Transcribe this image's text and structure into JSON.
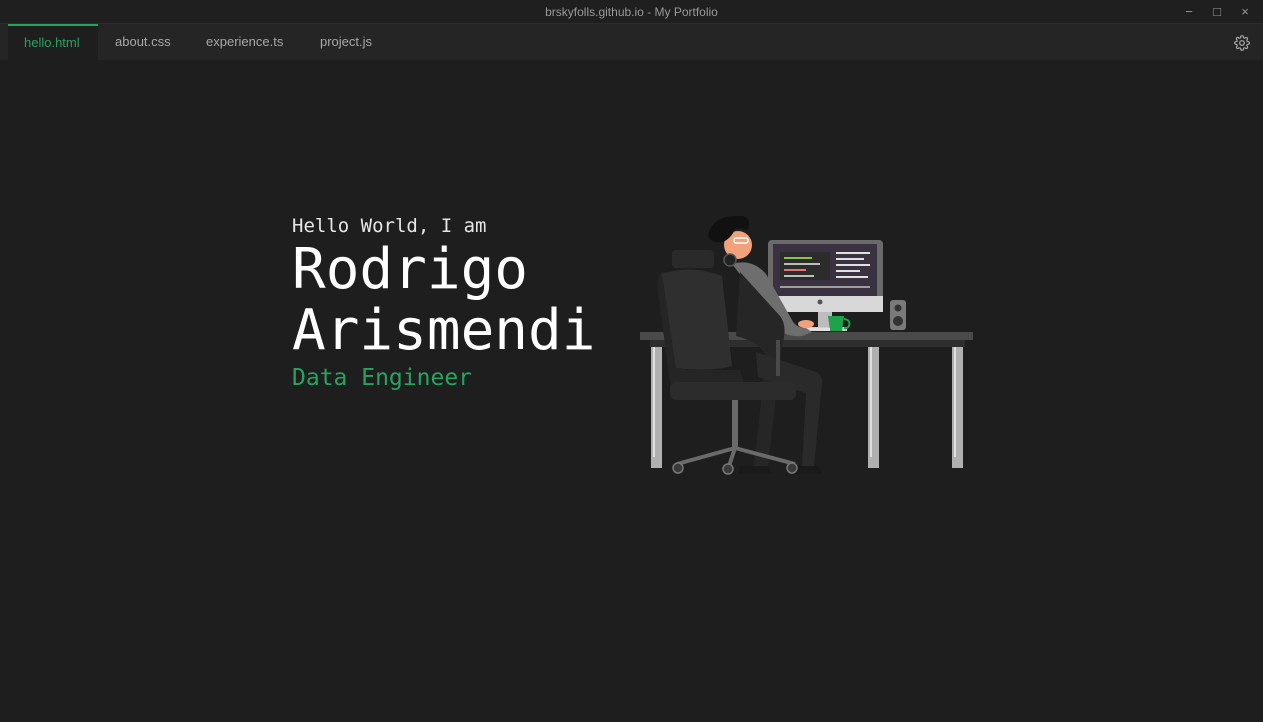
{
  "window": {
    "title": "brskyfolls.github.io - My Portfolio",
    "minimize": "−",
    "maximize": "□",
    "close": "×"
  },
  "tabs": [
    {
      "label": "hello.html",
      "active": true
    },
    {
      "label": "about.css",
      "active": false
    },
    {
      "label": "experience.ts",
      "active": false
    },
    {
      "label": "project.js",
      "active": false
    }
  ],
  "settings_icon": "gear-icon",
  "hero": {
    "greeting": "Hello World, I am",
    "first_name": "Rodrigo",
    "last_name": "Arismendi",
    "role": "Data Engineer"
  },
  "illustration": "developer-at-desk-illustration",
  "colors": {
    "background": "#1e1e1e",
    "accent": "#27a360",
    "tabbar": "#252526"
  }
}
